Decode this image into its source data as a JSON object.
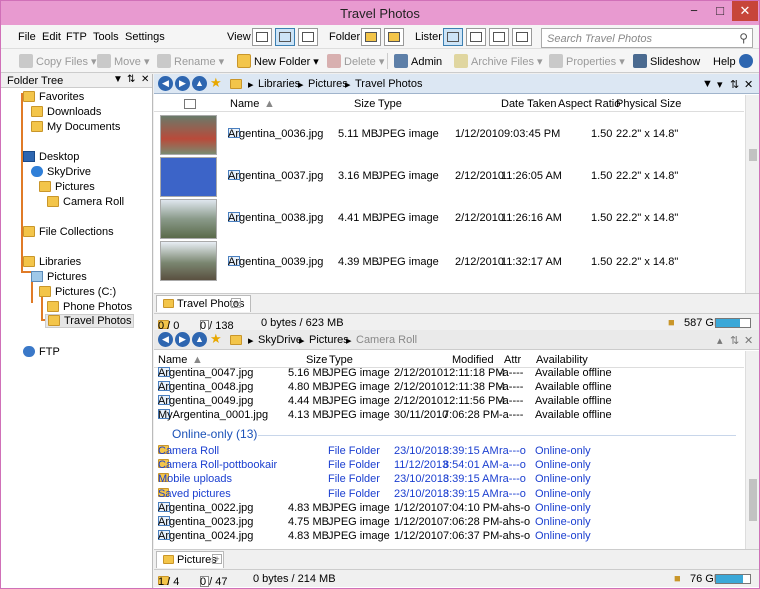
{
  "window": {
    "title": "Travel Photos",
    "min": "−",
    "max": "□",
    "close": "✕"
  },
  "menu": {
    "file": "File",
    "edit": "Edit",
    "ftp": "FTP",
    "tools": "Tools",
    "settings": "Settings",
    "view": "View",
    "folder": "Folder",
    "lister": "Lister"
  },
  "search": {
    "placeholder": "Search Travel Photos",
    "icon": "search-icon"
  },
  "toolbar": {
    "copy": "Copy Files",
    "move": "Move",
    "rename": "Rename",
    "new_folder": "New Folder",
    "delete": "Delete",
    "admin": "Admin",
    "archive": "Archive Files",
    "properties": "Properties",
    "slideshow": "Slideshow",
    "help": "Help"
  },
  "tree": {
    "header": "Folder Tree",
    "items": {
      "favorites": "Favorites",
      "downloads": "Downloads",
      "my_documents": "My Documents",
      "desktop": "Desktop",
      "skydrive": "SkyDrive",
      "pictures": "Pictures",
      "camera_roll": "Camera Roll",
      "file_collections": "File Collections",
      "libraries": "Libraries",
      "lib_pictures": "Pictures",
      "pictures_c": "Pictures (C:)",
      "phone_photos": "Phone Photos",
      "travel_photos": "Travel Photos",
      "ftp": "FTP"
    }
  },
  "top_pane": {
    "crumbs": [
      "Libraries",
      "Pictures",
      "Travel Photos"
    ],
    "columns": {
      "name": "Name",
      "size": "Size",
      "type": "Type",
      "date": "Date Taken",
      "aspect": "Aspect Ratio",
      "physical": "Physical Size"
    },
    "rows": [
      {
        "name": "Argentina_0036.jpg",
        "size": "5.11 MB",
        "type": "JPEG image",
        "date": "1/12/2010",
        "time": "9:03:45 PM",
        "aspect": "1.50",
        "physical": "22.2\" x 14.8\""
      },
      {
        "name": "Argentina_0037.jpg",
        "size": "3.16 MB",
        "type": "JPEG image",
        "date": "2/12/2010",
        "time": "11:26:05 AM",
        "aspect": "1.50",
        "physical": "22.2\" x 14.8\""
      },
      {
        "name": "Argentina_0038.jpg",
        "size": "4.41 MB",
        "type": "JPEG image",
        "date": "2/12/2010",
        "time": "11:26:16 AM",
        "aspect": "1.50",
        "physical": "22.2\" x 14.8\""
      },
      {
        "name": "Argentina_0039.jpg",
        "size": "4.39 MB",
        "type": "JPEG image",
        "date": "2/12/2010",
        "time": "11:32:17 AM",
        "aspect": "1.50",
        "physical": "22.2\" x 14.8\""
      }
    ],
    "tab": "Travel Photos",
    "status": {
      "folders": "0 / 0",
      "files": "0 / 138",
      "bytes": "0 bytes / 623 MB",
      "free": "587 GB",
      "disk_fraction": 0.7
    }
  },
  "bottom_pane": {
    "crumbs": [
      "SkyDrive",
      "Pictures",
      "Camera Roll"
    ],
    "columns": {
      "name": "Name",
      "size": "Size",
      "type": "Type",
      "modified": "Modified",
      "attr": "Attr",
      "availability": "Availability"
    },
    "rows": [
      {
        "name": "Argentina_0047.jpg",
        "size": "5.16 MB",
        "type": "JPEG image",
        "date": "2/12/2010",
        "time": "12:11:18 PM",
        "attr": "-a----",
        "avail": "Available offline"
      },
      {
        "name": "Argentina_0048.jpg",
        "size": "4.80 MB",
        "type": "JPEG image",
        "date": "2/12/2010",
        "time": "12:11:38 PM",
        "attr": "-a----",
        "avail": "Available offline"
      },
      {
        "name": "Argentina_0049.jpg",
        "size": "4.44 MB",
        "type": "JPEG image",
        "date": "2/12/2010",
        "time": "12:11:56 PM",
        "attr": "-a----",
        "avail": "Available offline"
      },
      {
        "name": "MyArgentina_0001.jpg",
        "size": "4.13 MB",
        "type": "JPEG image",
        "date": "30/11/2010",
        "time": "7:06:28 PM",
        "attr": "-a----",
        "avail": "Available offline"
      }
    ],
    "group": "Online-only (13)",
    "online_rows": [
      {
        "name": "Camera Roll",
        "size": "",
        "type": "File Folder",
        "date": "23/10/2013",
        "time": "8:39:15 AM",
        "attr": "ra---o",
        "avail": "Online-only",
        "folder": true
      },
      {
        "name": "Camera Roll-pottbookair",
        "size": "",
        "type": "File Folder",
        "date": "11/12/2013",
        "time": "8:54:01 AM",
        "attr": "-a---o",
        "avail": "Online-only",
        "folder": true
      },
      {
        "name": "Mobile uploads",
        "size": "",
        "type": "File Folder",
        "date": "23/10/2013",
        "time": "8:39:15 AM",
        "attr": "ra---o",
        "avail": "Online-only",
        "folder": true
      },
      {
        "name": "Saved pictures",
        "size": "",
        "type": "File Folder",
        "date": "23/10/2013",
        "time": "8:39:15 AM",
        "attr": "ra---o",
        "avail": "Online-only",
        "folder": true
      },
      {
        "name": "Argentina_0022.jpg",
        "size": "4.83 MB",
        "type": "JPEG image",
        "date": "1/12/2010",
        "time": "7:04:10 PM",
        "attr": "-ahs-o",
        "avail": "Online-only",
        "folder": false
      },
      {
        "name": "Argentina_0023.jpg",
        "size": "4.75 MB",
        "type": "JPEG image",
        "date": "1/12/2010",
        "time": "7:06:28 PM",
        "attr": "-ahs-o",
        "avail": "Online-only",
        "folder": false
      },
      {
        "name": "Argentina_0024.jpg",
        "size": "4.83 MB",
        "type": "JPEG image",
        "date": "1/12/2010",
        "time": "7:06:37 PM",
        "attr": "-ahs-o",
        "avail": "Online-only",
        "folder": false
      }
    ],
    "tab": "Pictures",
    "status": {
      "folders": "1 / 4",
      "files": "0 / 47",
      "bytes": "0 bytes / 214 MB",
      "free": "76 GB",
      "disk_fraction": 0.8
    }
  },
  "colors": {
    "title_bar": "#e89ad0",
    "accent": "#2e66b0",
    "online": "#1b3fd0"
  }
}
